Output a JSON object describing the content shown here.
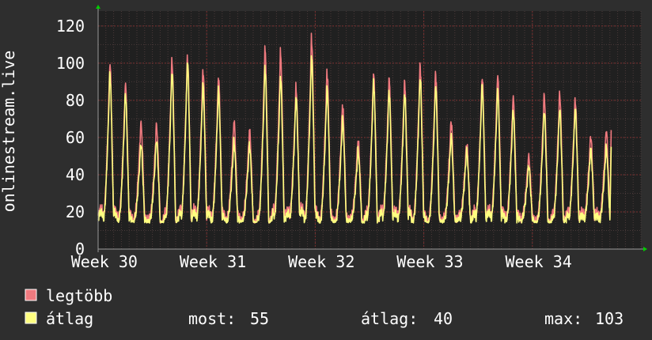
{
  "colors": {
    "background": "#2e2e2e",
    "plot_background": "#202020",
    "text": "#ffffff",
    "grid_minor": "#4a3a3a",
    "grid_major": "#7a2f2f",
    "axis": "#9a9a9a",
    "arrow": "#00cc00"
  },
  "chart_data": {
    "type": "line",
    "ylabel": "onlinestream.live",
    "ylim": [
      0,
      128
    ],
    "y_ticks": [
      0,
      20,
      40,
      60,
      80,
      100,
      120
    ],
    "x_tick_labels": [
      "Week 30",
      "Week 31",
      "Week 32",
      "Week 33",
      "Week 34"
    ],
    "grid": true,
    "legend_position": "bottom-left",
    "x_range_days": [
      0,
      35
    ],
    "series": [
      {
        "name": "legtöbb",
        "color": "#f07a7f",
        "daily_peaks": [
          100,
          89,
          68,
          67,
          102,
          104,
          97,
          93,
          69,
          64,
          108,
          106,
          87,
          114,
          96,
          78,
          59,
          95,
          92,
          90,
          99,
          95,
          69,
          57,
          93,
          94,
          82,
          50,
          83,
          84,
          81,
          61,
          64
        ],
        "last": 64
      },
      {
        "name": "átlag",
        "color": "#ffff80",
        "daily_peaks": [
          95,
          84,
          57,
          59,
          96,
          101,
          89,
          86,
          58,
          56,
          98,
          93,
          82,
          104,
          87,
          70,
          53,
          90,
          85,
          84,
          93,
          88,
          61,
          53,
          88,
          86,
          75,
          45,
          75,
          76,
          76,
          54,
          55
        ],
        "last": 55
      }
    ],
    "stats": {
      "most_label": "most:",
      "most_value": "55",
      "avg_label": "átlag:",
      "avg_value": "40",
      "max_label": "max:",
      "max_value": "103"
    }
  }
}
